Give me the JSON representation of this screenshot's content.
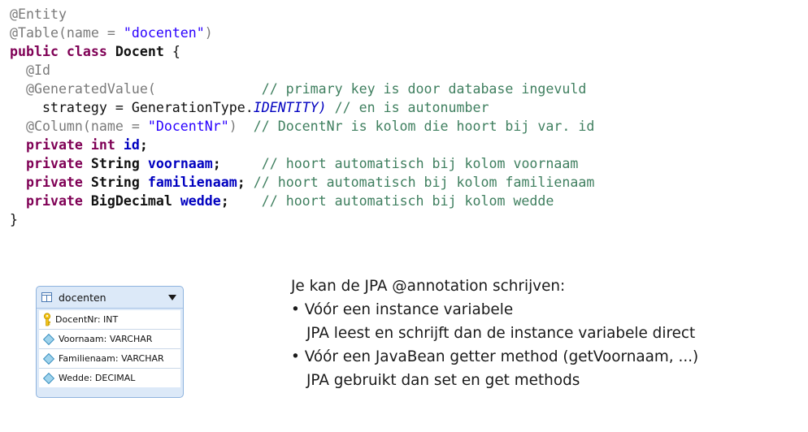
{
  "code": {
    "l1": "@Entity",
    "l2_anno": "@Table(name = ",
    "l2_str": "\"docenten\"",
    "l2_end": ")",
    "l3_kw1": "public class",
    "l3_name": " Docent ",
    "l3_brace": "{",
    "l4": "  @Id",
    "l5_anno": "  @GeneratedValue(",
    "l5_cmt": "// primary key is door database ingevuld",
    "l6_pre": "    strategy = GenerationType.",
    "l6_enum": "IDENTITY",
    "l6_post": ")",
    "l6_cmt": " // en is autonumber",
    "l7_anno": "  @Column(name = ",
    "l7_str": "\"DocentNr\"",
    "l7_end": ")",
    "l7_cmt": "// DocentNr is kolom die hoort bij var. id",
    "l8_kw": "  private int",
    "l8_field": "id",
    "l8_semi": ";",
    "l9_kw": "  private",
    "l9_type": " String ",
    "l9_field": "voornaam",
    "l9_semi": ";",
    "l9_cmt": "// hoort automatisch bij kolom voornaam",
    "l10_kw": "  private",
    "l10_type": " String ",
    "l10_field": "familienaam",
    "l10_semi": ";",
    "l10_cmt": "// hoort automatisch bij kolom familienaam",
    "l11_kw": "  private",
    "l11_type": " BigDecimal ",
    "l11_field": "wedde",
    "l11_semi": ";",
    "l11_cmt": "// hoort automatisch bij kolom wedde",
    "l12": "}"
  },
  "table_widget": {
    "title": "docenten",
    "columns": [
      {
        "label": "DocentNr: INT",
        "icon": "key-icon"
      },
      {
        "label": "Voornaam: VARCHAR",
        "icon": "diamond-icon"
      },
      {
        "label": "Familienaam: VARCHAR",
        "icon": "diamond-icon"
      },
      {
        "label": "Wedde: DECIMAL",
        "icon": "diamond-icon"
      }
    ]
  },
  "notes": {
    "heading": "Je kan de JPA @annotation schrijven:",
    "bullet1": "• Vóór een instance variabele",
    "bullet1_sub": "JPA leest en schrijft dan de instance variabele direct",
    "bullet2": "• Vóór een JavaBean getter method (getVoornaam,  ...)",
    "bullet2_sub": "JPA gebruikt dan set en get methods"
  }
}
